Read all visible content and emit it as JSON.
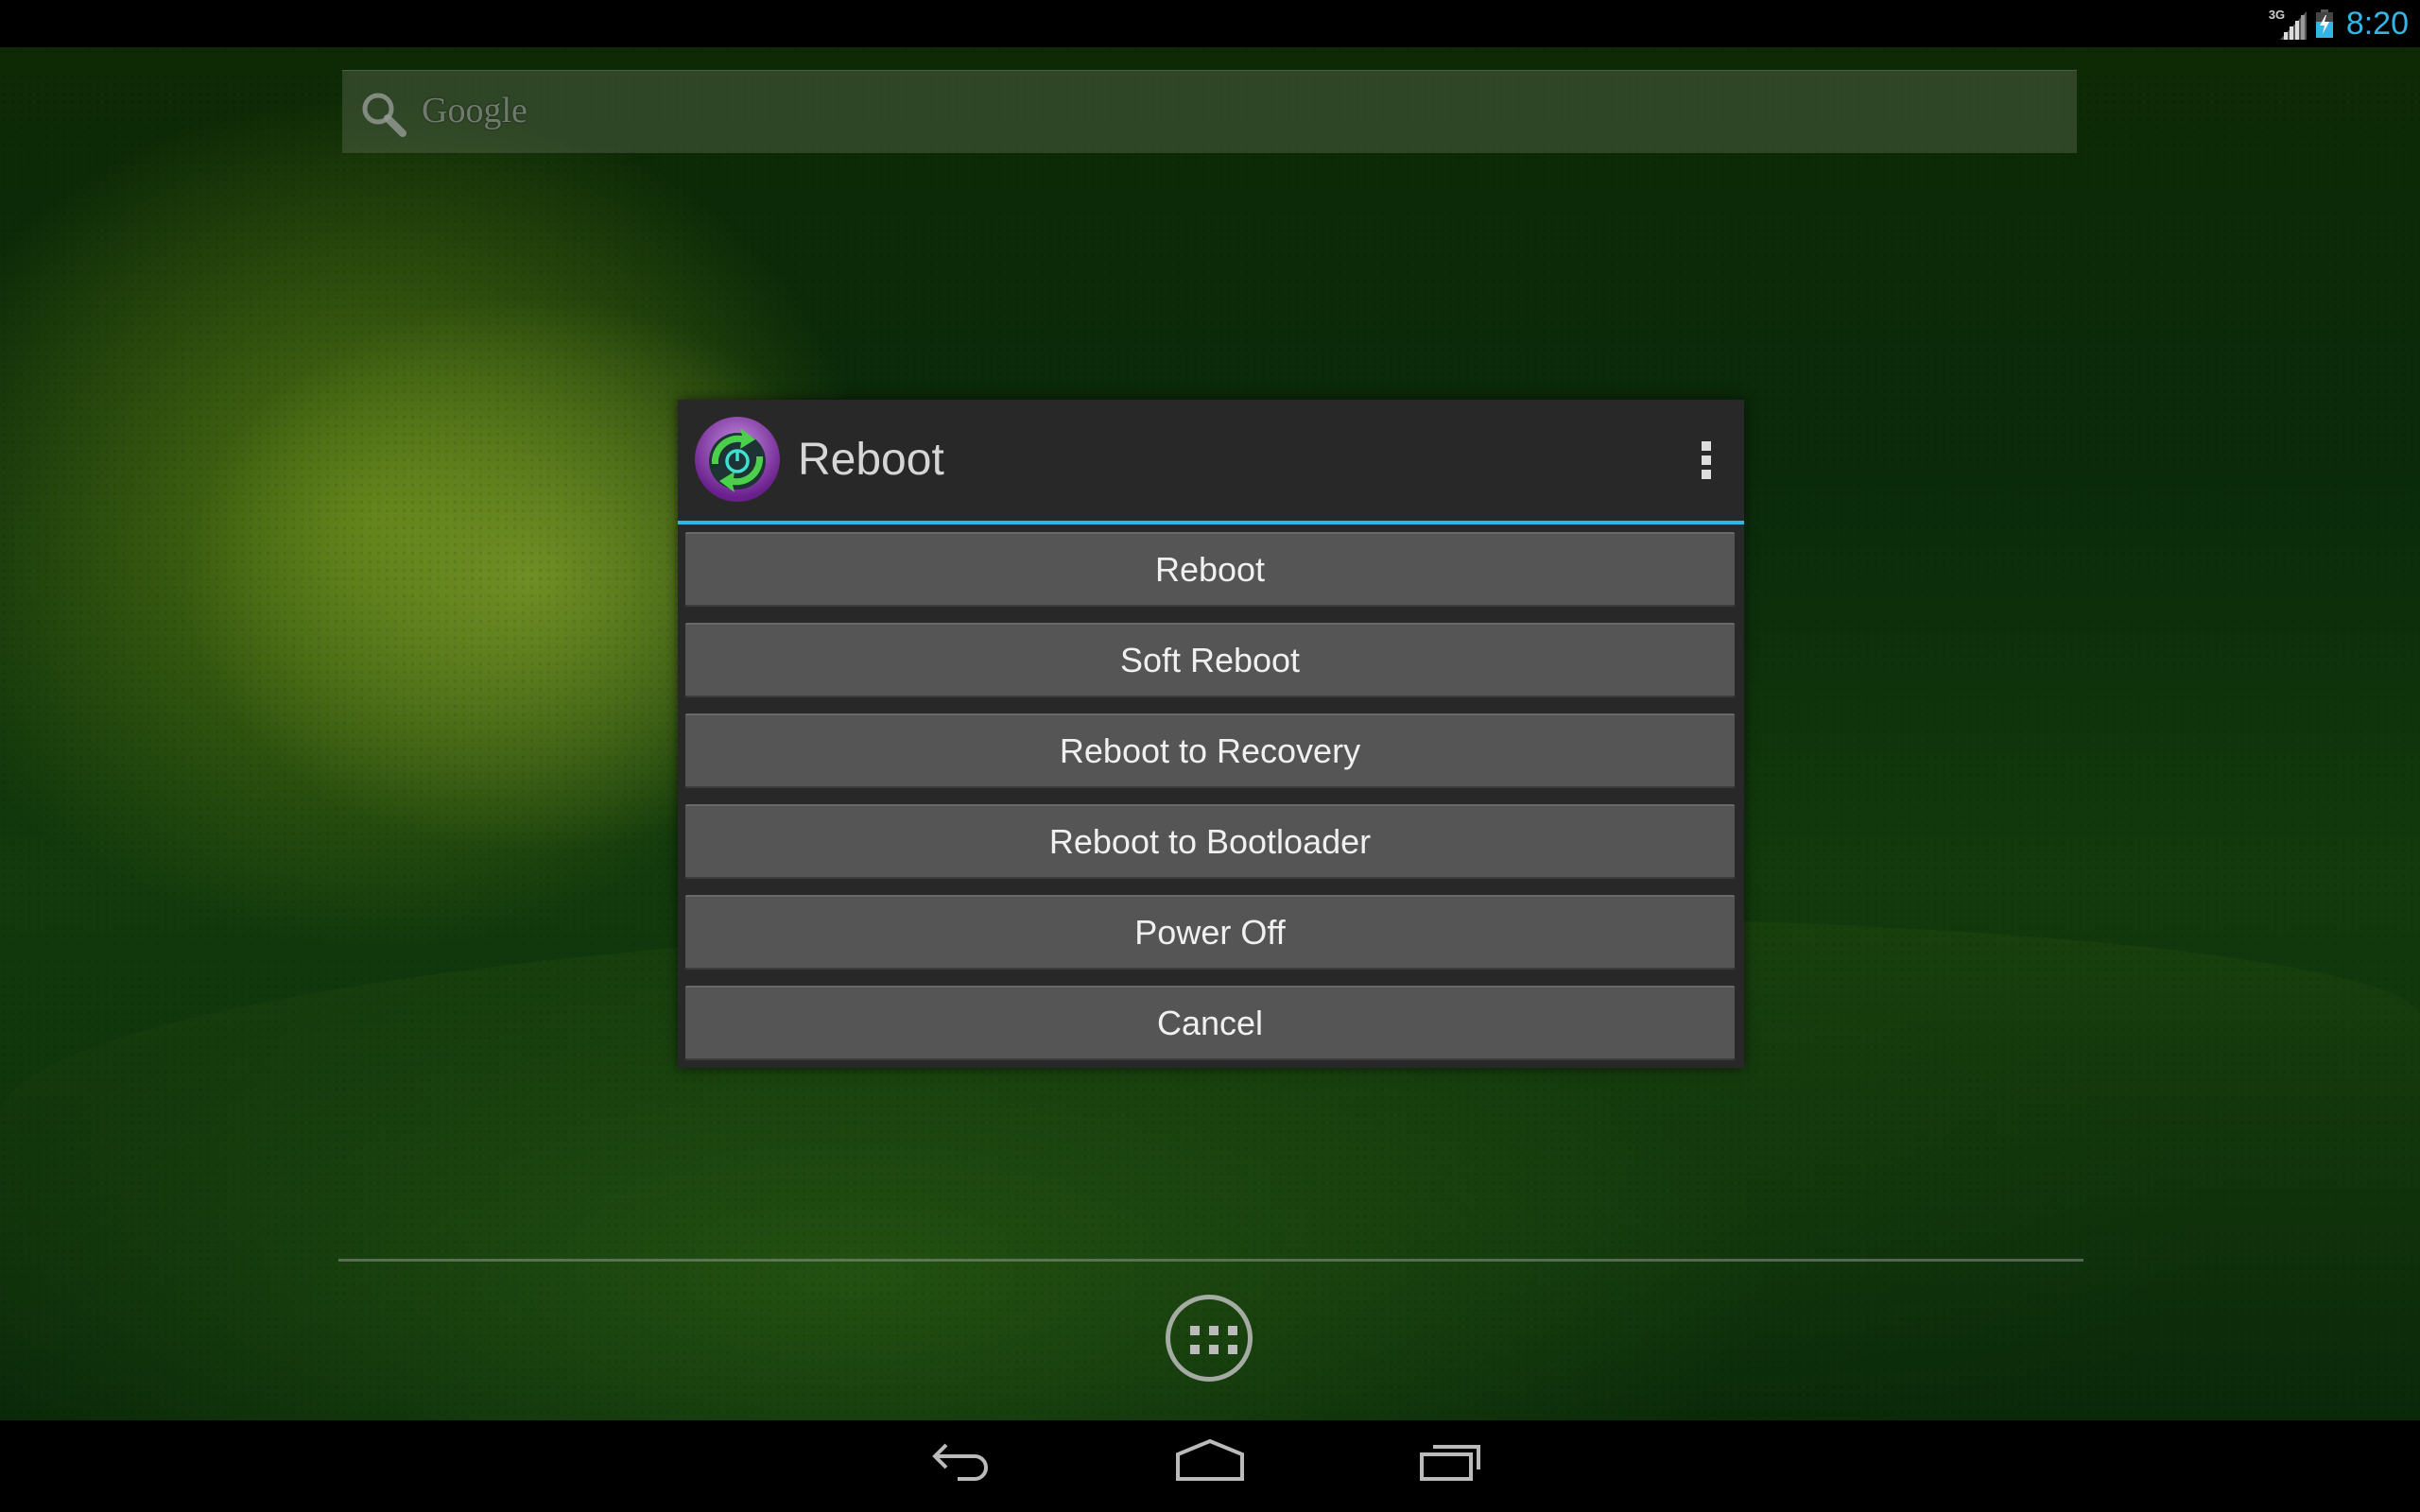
{
  "status_bar": {
    "network_type": "3G",
    "time": "8:20",
    "battery_state": "charging",
    "icons": [
      "signal-icon",
      "battery-charging-icon"
    ],
    "accent_color": "#33b5e5"
  },
  "search_widget": {
    "placeholder": "Google",
    "icon": "search-icon"
  },
  "dialog": {
    "title": "Reboot",
    "app_icon": "reboot-app-icon",
    "menu_icon": "overflow-menu-icon",
    "accent_color": "#33b5e5",
    "buttons": [
      {
        "label": "Reboot"
      },
      {
        "label": "Soft Reboot"
      },
      {
        "label": "Reboot to Recovery"
      },
      {
        "label": "Reboot to Bootloader"
      },
      {
        "label": "Power Off"
      },
      {
        "label": "Cancel"
      }
    ]
  },
  "dock": {
    "app_drawer_icon": "app-drawer-icon"
  },
  "nav_bar": {
    "buttons": [
      {
        "name": "back",
        "icon": "back-icon"
      },
      {
        "name": "home",
        "icon": "home-icon"
      },
      {
        "name": "recents",
        "icon": "recents-icon"
      }
    ]
  }
}
